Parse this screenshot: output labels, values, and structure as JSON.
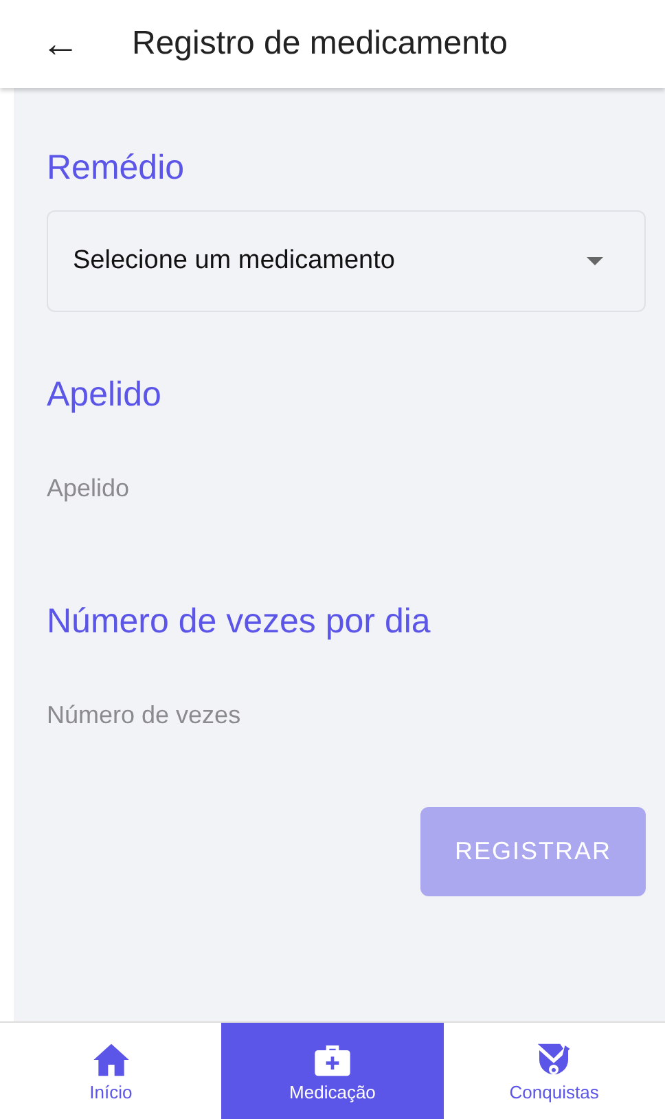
{
  "header": {
    "back": "←",
    "title": "Registro de medicamento"
  },
  "fields": [
    {
      "label": "Remédio",
      "kind": "select",
      "value": "Selecione um medicamento"
    },
    {
      "label": "Apelido",
      "kind": "input",
      "placeholder": "Apelido"
    },
    {
      "label": "Número de vezes por dia",
      "kind": "input",
      "placeholder": "Número de vezes"
    }
  ],
  "submit": {
    "label": "REGISTRAR",
    "disabled": true
  },
  "nav": [
    {
      "label": "Início",
      "selected": false
    },
    {
      "label": "Medicação",
      "selected": true
    },
    {
      "label": "Conquistas",
      "selected": false
    }
  ]
}
